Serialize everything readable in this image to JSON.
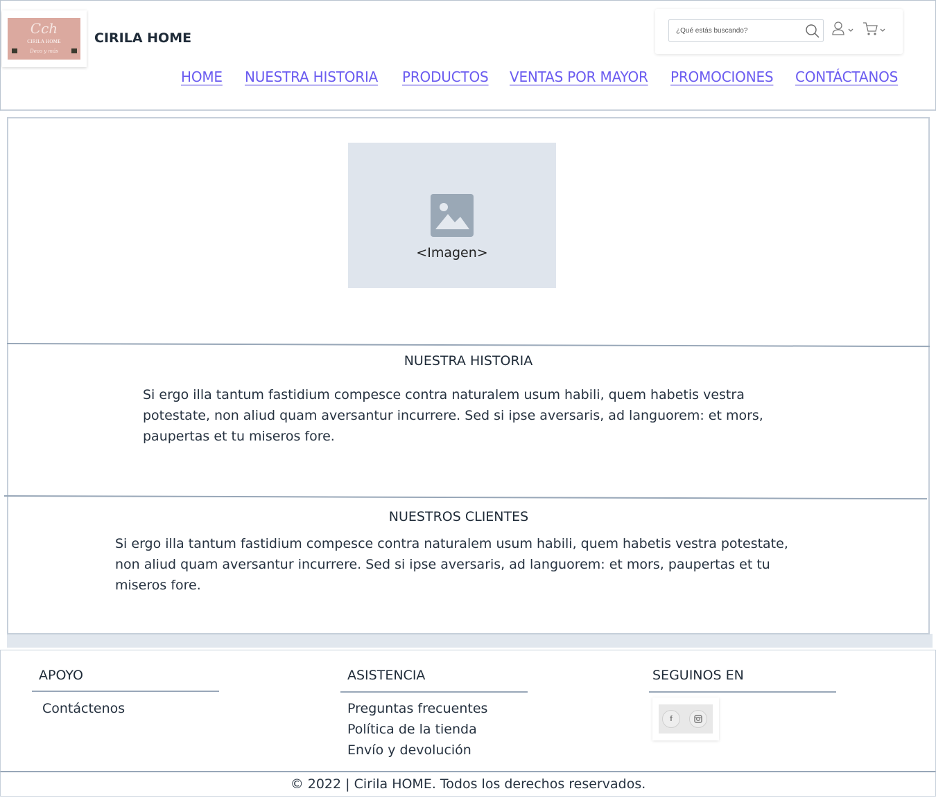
{
  "header": {
    "brand": "CIRILA HOME",
    "logo": {
      "monogram": "Cch",
      "name": "CIRILA HOME",
      "tagline": "Deco y más",
      "color": "#dba99f"
    },
    "search": {
      "placeholder": "¿Qué estás buscando?",
      "value": ""
    },
    "icons": {
      "search": "search-icon",
      "user": "user-icon",
      "cart": "cart-icon"
    }
  },
  "nav": {
    "items": [
      {
        "label": "HOME"
      },
      {
        "label": "NUESTRA HISTORIA"
      },
      {
        "label": "PRODUCTOS"
      },
      {
        "label": "VENTAS POR MAYOR"
      },
      {
        "label": "PROMOCIONES"
      },
      {
        "label": "CONTÁCTANOS"
      }
    ],
    "color": "#6b5cf0"
  },
  "hero": {
    "image_caption": "<Imagen>"
  },
  "story": {
    "title": "NUESTRA HISTORIA",
    "lines": [
      "Si ergo illa tantum fastidium compesce contra naturalem usum habili, quem habetis vestra",
      "potestate, non aliud quam aversantur incurrere. Sed si ipse aversaris, ad languorem: et mors,",
      "paupertas et tu miseros fore."
    ]
  },
  "clients": {
    "title": "NUESTROS CLIENTES",
    "lines": [
      "Si ergo illa tantum fastidium compesce contra naturalem usum habili, quem habetis vestra potestate,",
      "non aliud quam aversantur incurrere. Sed si ipse aversaris, ad languorem: et mors, paupertas et tu",
      "miseros fore."
    ]
  },
  "footer": {
    "apoyo": {
      "title": "APOYO",
      "links": [
        "Contáctenos"
      ]
    },
    "asistencia": {
      "title": "ASISTENCIA",
      "links": [
        "Preguntas frecuentes",
        "Política de la tienda",
        "Envío y devolución"
      ]
    },
    "social": {
      "title": "SEGUINOS EN",
      "facebook": "f",
      "instagram": "instagram-icon"
    },
    "copyright": "© 2022 | Cirila HOME. Todos los derechos reservados."
  }
}
